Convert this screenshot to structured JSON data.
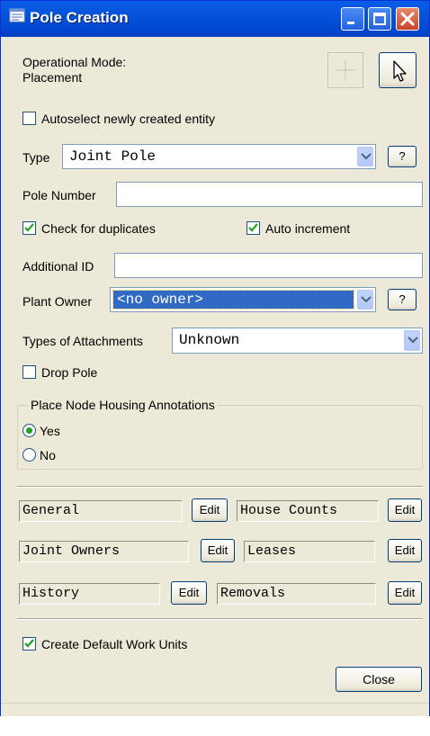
{
  "window": {
    "title": "Pole Creation"
  },
  "mode": {
    "line1": "Operational Mode:",
    "line2": "Placement"
  },
  "autoselect": {
    "label": "Autoselect newly created entity",
    "checked": false
  },
  "type": {
    "label": "Type",
    "value": "Joint Pole",
    "help": "?"
  },
  "pole_number": {
    "label": "Pole Number",
    "value": ""
  },
  "check_duplicates": {
    "label": "Check for duplicates",
    "checked": true
  },
  "auto_increment": {
    "label": "Auto increment",
    "checked": true
  },
  "additional_id": {
    "label": "Additional ID",
    "value": ""
  },
  "plant_owner": {
    "label": "Plant Owner",
    "value": "<no owner>",
    "help": "?"
  },
  "attachments": {
    "label": "Types of Attachments",
    "value": "Unknown"
  },
  "drop_pole": {
    "label": "Drop Pole",
    "checked": false
  },
  "housing": {
    "legend": "Place Node Housing Annotations",
    "yes": "Yes",
    "no": "No",
    "selected": "Yes"
  },
  "sections": {
    "edit_label": "Edit",
    "general": "General",
    "house_counts": "House Counts",
    "joint_owners": "Joint Owners",
    "leases": "Leases",
    "history": "History",
    "removals": "Removals"
  },
  "default_units": {
    "label": "Create Default Work Units",
    "checked": true
  },
  "close_label": "Close",
  "colors": {
    "titlebar": "#0553d9",
    "selection": "#316ac5",
    "check": "#21a121"
  }
}
